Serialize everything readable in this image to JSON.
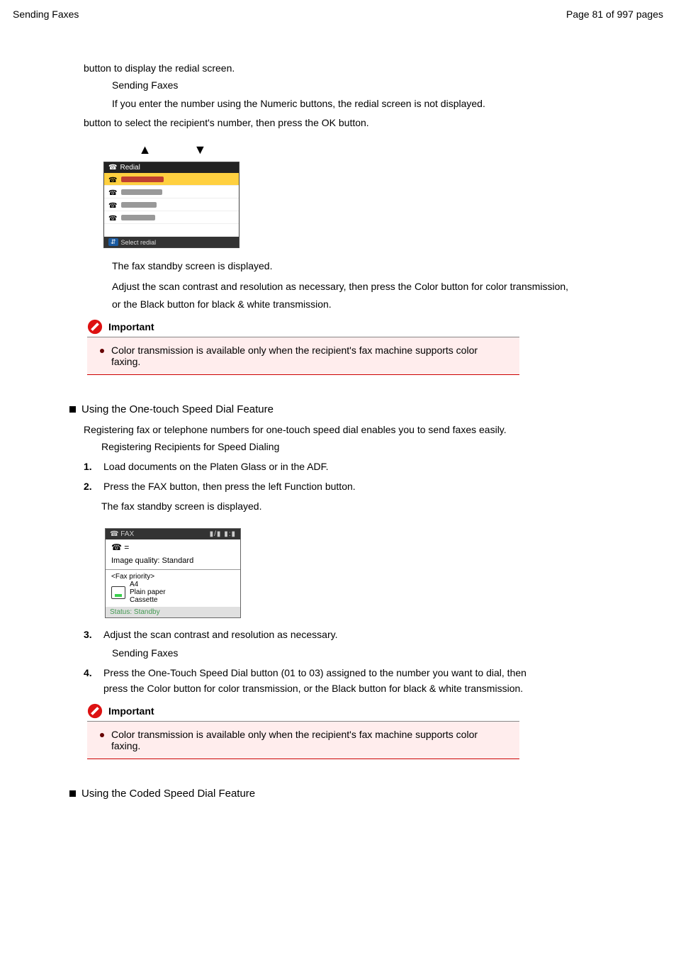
{
  "header": {
    "left": "Sending Faxes",
    "right": "Page 81 of 997 pages"
  },
  "step3": {
    "line": "button to display the redial screen.",
    "ref": "Sending Faxes",
    "para1": "If you enter the number using the Numeric buttons, the redial screen is not displayed.",
    "step4": "button to select the recipient's number, then press the OK button."
  },
  "redial_screen": {
    "title": "Redial",
    "footer": "Select redial"
  },
  "post_redial": {
    "p1": "The fax standby screen is displayed.",
    "p2a": "Adjust the scan contrast and resolution as necessary, then press the Color button for color transmission,",
    "p2b": "or the Black button for black & white transmission."
  },
  "important1": {
    "label": "Important",
    "text": "Color transmission is available only when the recipient's fax machine supports color faxing."
  },
  "subsection1": {
    "title": "Using the One-touch Speed Dial Feature",
    "intro": "Registering fax or telephone numbers for one-touch speed dial enables you to send faxes easily.",
    "ref": "Registering Recipients for Speed Dialing"
  },
  "steps_b": {
    "s1": "Load documents on the Platen Glass or in the ADF.",
    "s2": "Press the FAX button, then press the left Function button.",
    "s2b": "The fax standby screen is displayed."
  },
  "fax_screen": {
    "title": "FAX",
    "tel": "☎ =",
    "iq": "Image quality: Standard",
    "priority_label": "<Fax priority>",
    "size": "A4",
    "paper": "Plain paper",
    "source": "Cassette",
    "status": "Status: Standby"
  },
  "steps_c": {
    "s3": "Adjust the scan contrast and resolution as necessary.",
    "ref": "Sending Faxes",
    "s4a": "Press the One-Touch Speed Dial button (01 to 03) assigned to the number you want to dial, then",
    "s4b": "press the Color button for color transmission, or the Black button for black & white transmission."
  },
  "important2": {
    "label": "Important",
    "text": "Color transmission is available only when the recipient's fax machine supports color faxing."
  },
  "subsection2": {
    "title": "Using the Coded Speed Dial Feature"
  }
}
